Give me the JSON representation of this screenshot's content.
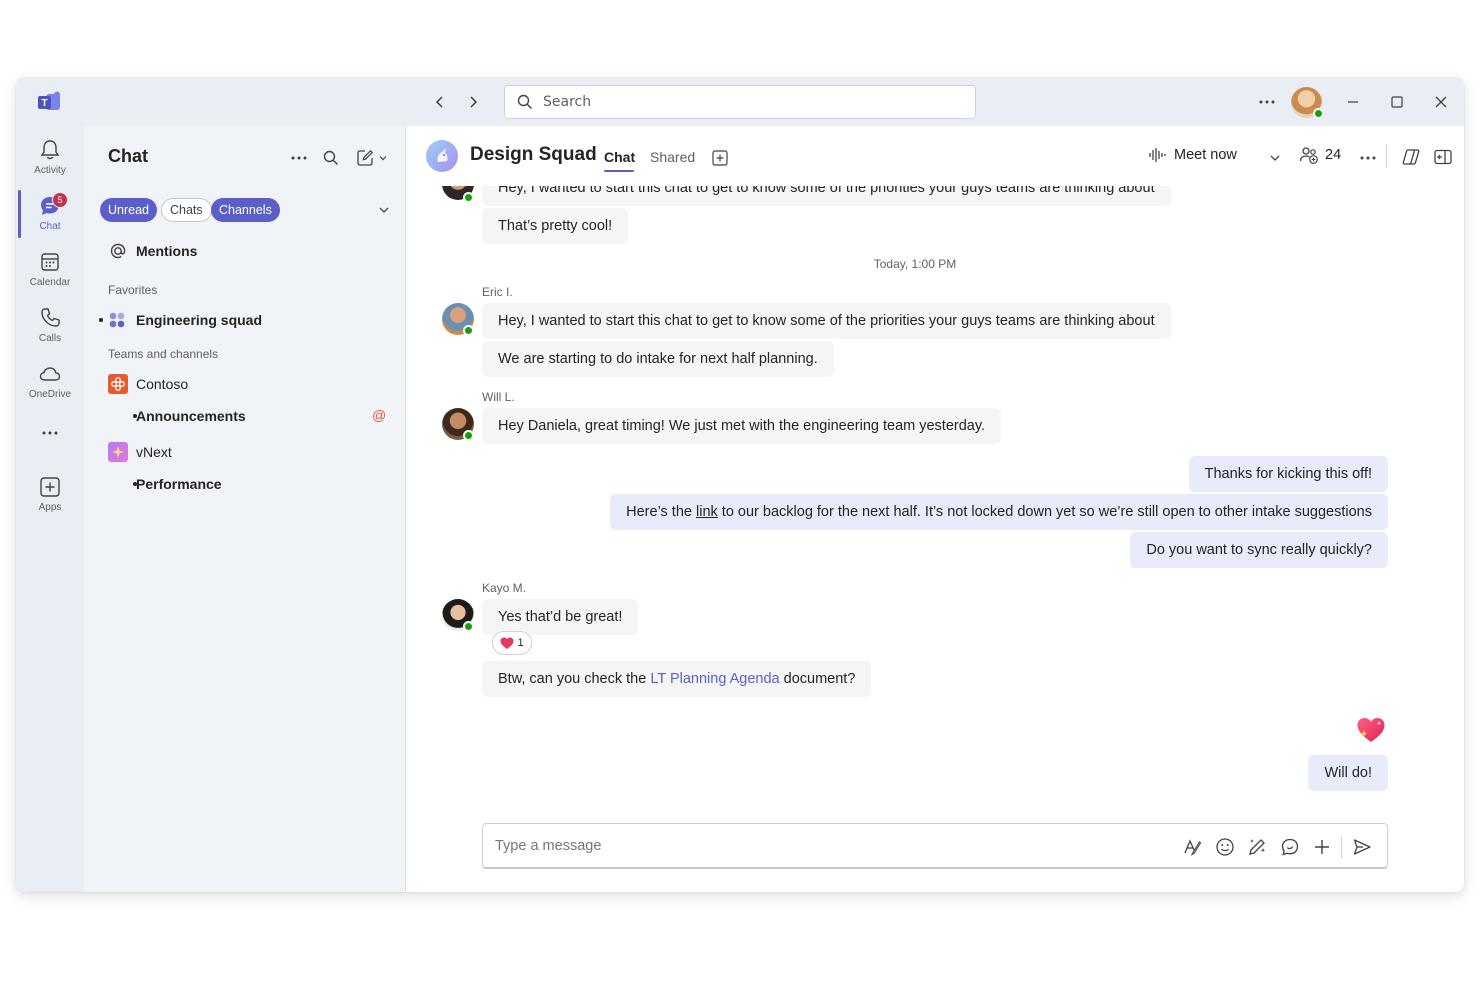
{
  "titlebar": {
    "search_placeholder": "Search"
  },
  "rail": {
    "items": [
      {
        "label": "Activity",
        "icon": "bell-icon"
      },
      {
        "label": "Chat",
        "icon": "chat-icon",
        "badge": "5"
      },
      {
        "label": "Calendar",
        "icon": "calendar-icon"
      },
      {
        "label": "Calls",
        "icon": "phone-icon"
      },
      {
        "label": "OneDrive",
        "icon": "cloud-icon"
      },
      {
        "label": "Apps",
        "icon": "add-app-icon"
      }
    ]
  },
  "listpane": {
    "title": "Chat",
    "filters": [
      "Unread",
      "Chats",
      "Channels"
    ],
    "mentions": "Mentions",
    "favorites_label": "Favorites",
    "favorites": [
      "Engineering squad"
    ],
    "teams_label": "Teams and channels",
    "teams": [
      {
        "name": "Contoso",
        "channels": [
          "Announcements"
        ],
        "mention_badge": "@"
      },
      {
        "name": "vNext",
        "channels": [
          "Performance"
        ]
      }
    ]
  },
  "chat": {
    "title": "Design Squad",
    "tabs": [
      "Chat",
      "Shared"
    ],
    "meet_now": "Meet now",
    "participants": "24",
    "timestamp": "Today, 1:00 PM",
    "messages": {
      "m0": "Hey, I wanted to start this chat to get to know some of the priorities your guys teams are thinking about",
      "m1": "That’s pretty cool!",
      "eric_name": "Eric I.",
      "m2": "Hey, I wanted to start this chat to get to know some of the priorities your guys teams are thinking about",
      "m3": "We are starting to do intake for next half planning.",
      "will_name": "Will L.",
      "m4": "Hey Daniela, great timing! We just met with the engineering team yesterday.",
      "o1": "Thanks for kicking this off!",
      "o2_pre": "Here’s the ",
      "o2_link": "link",
      "o2_post": " to our backlog for the next half. It’s not locked down yet so we’re still open to other intake suggestions",
      "o3": "Do you want to sync really quickly?",
      "kayo_name": "Kayo M.",
      "m5": "Yes that’d be great!",
      "reaction_count": "1",
      "m6_pre": "Btw, can you check the ",
      "m6_link": "LT Planning Agenda",
      "m6_post": " document?",
      "o4": "Will do!"
    },
    "compose_placeholder": "Type a message"
  },
  "colors": {
    "accent": "#5b5fc7",
    "rail_bg": "#e9eef5",
    "list_bg": "#f0f3f8",
    "outgoing_bubble": "#e8ebfa",
    "incoming_bubble": "#f5f5f5",
    "presence": "#13a10e",
    "badge": "#c4314b"
  }
}
